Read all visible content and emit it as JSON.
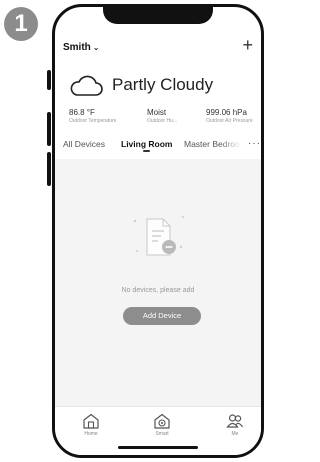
{
  "step": {
    "number": "1"
  },
  "header": {
    "home_name": "Smith",
    "add_label": "+"
  },
  "weather": {
    "condition": "Partly Cloudy",
    "stats": [
      {
        "value": "86.8 °F",
        "label": "Outdoor Temperature"
      },
      {
        "value": "Moist",
        "label": "Outdoor Hu..."
      },
      {
        "value": "999.06 hPa",
        "label": "Outdoor Air Pressure"
      }
    ]
  },
  "tabs": {
    "items": [
      "All Devices",
      "Living Room",
      "Master Bedroo"
    ],
    "active": "Living Room",
    "more_label": "···"
  },
  "empty_state": {
    "message": "No devices, please add",
    "button_label": "Add Device"
  },
  "nav": {
    "items": [
      "Home",
      "Smart",
      "Me"
    ]
  },
  "colors": {
    "button_gray": "#8d8d8d",
    "content_bg": "#f4f4f4"
  }
}
